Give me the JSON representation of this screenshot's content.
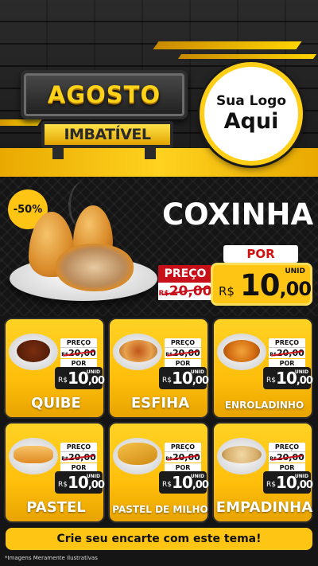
{
  "header": {
    "campaign_line1": "AGOSTO",
    "campaign_line2": "IMBATÍVEL",
    "logo_line1": "Sua Logo",
    "logo_line2": "Aqui"
  },
  "hero": {
    "discount_badge": "-50%",
    "product": "COXINHA",
    "por_label": "POR",
    "preco_label": "PREÇO",
    "old_price_currency": "R$",
    "old_price": "20,00",
    "currency": "R$",
    "price_int": "10",
    "price_dec": ",00",
    "unit": "UNID"
  },
  "products": [
    {
      "name": "QUIBE",
      "preco_label": "PREÇO",
      "old_currency": "R$",
      "old_price": "20,00",
      "por_label": "POR",
      "currency": "R$",
      "price_int": "10",
      "price_dec": ",00",
      "unit": "UNID"
    },
    {
      "name": "ESFIHA",
      "preco_label": "PREÇO",
      "old_currency": "R$",
      "old_price": "20,00",
      "por_label": "POR",
      "currency": "R$",
      "price_int": "10",
      "price_dec": ",00",
      "unit": "UNID"
    },
    {
      "name": "ENROLADINHO",
      "preco_label": "PREÇO",
      "old_currency": "R$",
      "old_price": "20,00",
      "por_label": "POR",
      "currency": "R$",
      "price_int": "10",
      "price_dec": ",00",
      "unit": "UNID"
    },
    {
      "name": "PASTEL",
      "preco_label": "PREÇO",
      "old_currency": "R$",
      "old_price": "20,00",
      "por_label": "POR",
      "currency": "R$",
      "price_int": "10",
      "price_dec": ",00",
      "unit": "UNID"
    },
    {
      "name": "PASTEL DE MILHO",
      "preco_label": "PREÇO",
      "old_currency": "R$",
      "old_price": "20,00",
      "por_label": "POR",
      "currency": "R$",
      "price_int": "10",
      "price_dec": ",00",
      "unit": "UNID"
    },
    {
      "name": "EMPADINHA",
      "preco_label": "PREÇO",
      "old_currency": "R$",
      "old_price": "20,00",
      "por_label": "POR",
      "currency": "R$",
      "price_int": "10",
      "price_dec": ",00",
      "unit": "UNID"
    }
  ],
  "footer": {
    "cta": "Crie seu encarte com este tema!",
    "disclaimer": "*Imagens Meramente Ilustrativas"
  },
  "colors": {
    "accent_yellow": "#ffc514",
    "price_red": "#c8101b",
    "background": "#151515"
  }
}
